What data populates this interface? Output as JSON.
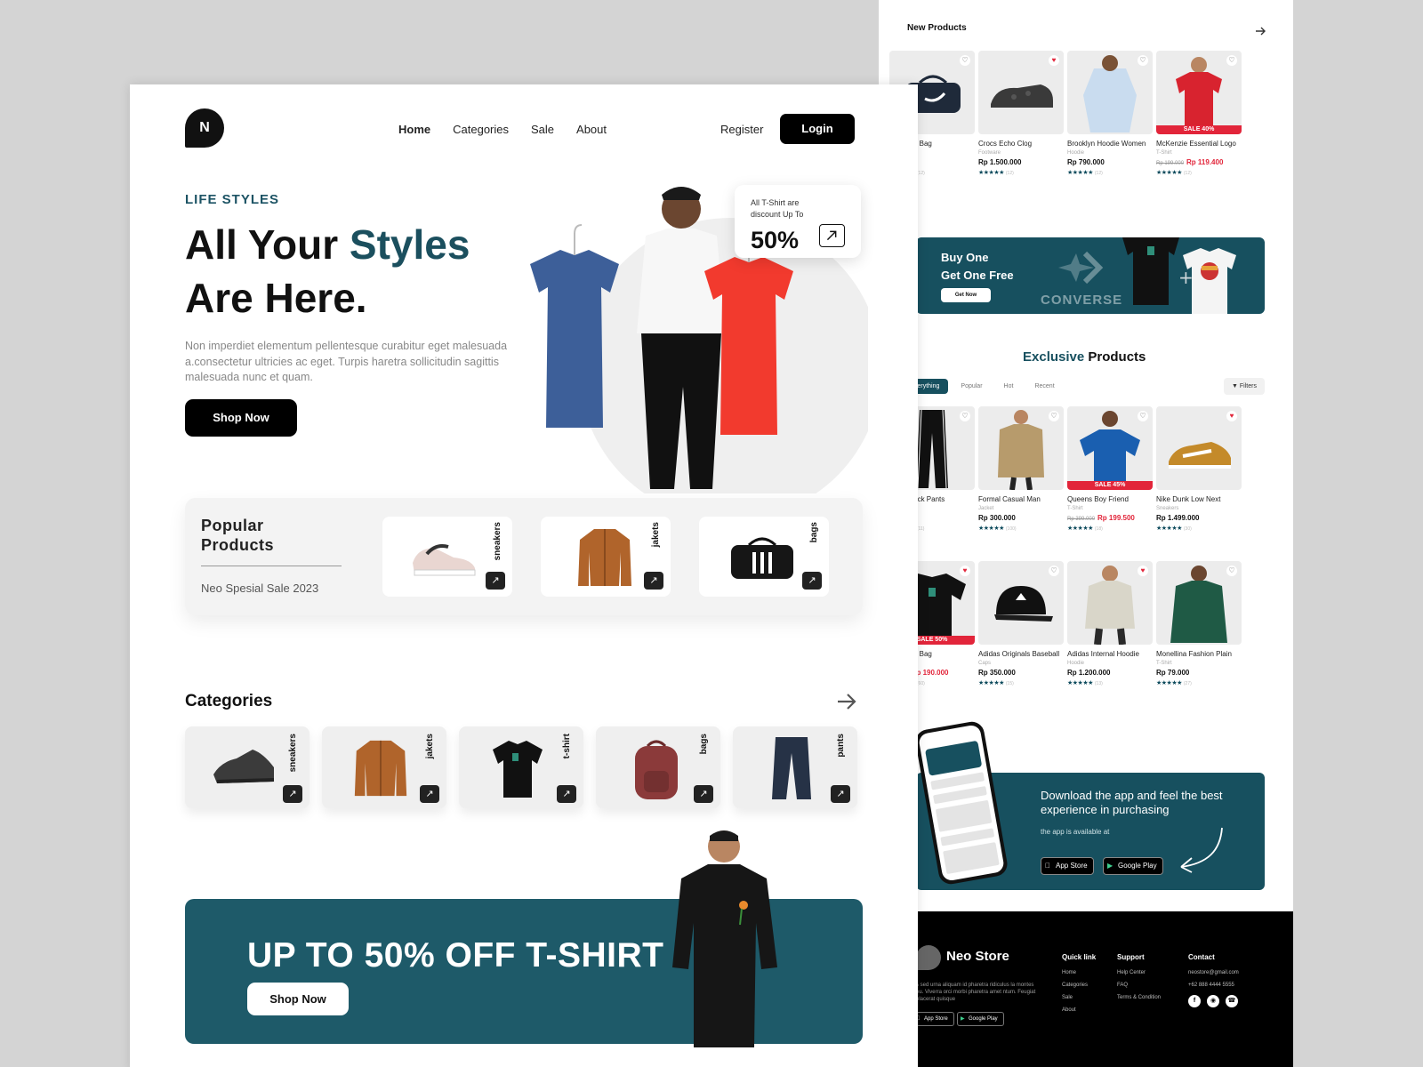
{
  "right": {
    "new_products_title": "New Products",
    "new_products": [
      {
        "name": "ke Duffle Bag",
        "cat": "gs",
        "price": "380.000",
        "reviews": "(12)",
        "heart": "outline",
        "img": "duffle-bag"
      },
      {
        "name": "Crocs Echo Clog",
        "cat": "Footware",
        "price": "Rp 1.500.000",
        "reviews": "(12)",
        "heart": "red",
        "img": "clog"
      },
      {
        "name": "Brooklyn Hoodie Women",
        "cat": "Hoodie",
        "price": "Rp 790.000",
        "reviews": "(12)",
        "heart": "outline",
        "img": "hoodie"
      },
      {
        "name": "McKenzie Essential Logo",
        "cat": "T-Shirt",
        "old_price": "Rp 199.000",
        "price": "Rp 119.400",
        "sale": "SALE 40%",
        "reviews": "(12)",
        "heart": "outline",
        "img": "tshirt-red"
      }
    ],
    "promo": {
      "line1": "Buy One",
      "line2": "Get One Free",
      "button": "Get Now",
      "brand": "CONVERSE"
    },
    "exclusive_title_a": "Exclusive",
    "exclusive_title_b": " Products",
    "tabs": [
      "verything",
      "Popular",
      "Hot",
      "Recent"
    ],
    "filters_label": "Filters",
    "exclusive_row1": [
      {
        "name": "ebird Track Pants",
        "cat": "nts",
        "price": "700.000",
        "reviews": "(11)",
        "heart": "outline",
        "img": "pants"
      },
      {
        "name": "Formal Casual Man",
        "cat": "Jacket",
        "price": "Rp 300.000",
        "reviews": "(100)",
        "heart": "outline",
        "img": "jacket"
      },
      {
        "name": "Queens Boy Friend",
        "cat": "T-Shirt",
        "old_price": "Rp 399.000",
        "price": "Rp 199.500",
        "sale": "SALE 45%",
        "reviews": "(18)",
        "heart": "outline",
        "img": "tshirt-blue"
      },
      {
        "name": "Nike Dunk Low Next",
        "cat": "Sneakers",
        "price": "Rp 1.499.000",
        "reviews": "(30)",
        "heart": "red",
        "img": "sneaker"
      }
    ],
    "exclusive_row2": [
      {
        "name": "ke Duffle Bag",
        "cat": "gs",
        "old_price": "800.000",
        "price": "Rp 190.000",
        "sale": "SALE 50%",
        "reviews": "(60)",
        "heart": "red",
        "img": "tshirt-black"
      },
      {
        "name": "Adidas Originals Baseball",
        "cat": "Caps",
        "price": "Rp 350.000",
        "reviews": "(15)",
        "heart": "outline",
        "img": "cap"
      },
      {
        "name": "Adidas Internal Hoodie",
        "cat": "Hoodie",
        "price": "Rp 1.200.000",
        "reviews": "(13)",
        "heart": "red",
        "img": "hoodie-man"
      },
      {
        "name": "Monellina Fashion Plain",
        "cat": "T-Shirt",
        "price": "Rp 79.000",
        "reviews": "(27)",
        "heart": "outline",
        "img": "green-top"
      }
    ],
    "app": {
      "heading": "Download the app and feel the best experience in purchasing",
      "sub": "the app is available at",
      "appstore": "App Store",
      "appstore_small": "Download on the",
      "googleplay": "Google Play",
      "googleplay_small": "GET IT ON"
    },
    "footer": {
      "brand": "Neo Store",
      "desc": "s sed urna aliquam id pharetra ridiculus la montes eu. Viverra orci morbi pharetra amet ntum. Feugiat placerat quisque",
      "quick_title": "Quick link",
      "quick": [
        "Home",
        "Categories",
        "Sale",
        "About"
      ],
      "support_title": "Support",
      "support": [
        "Help Center",
        "FAQ",
        "Terms & Condition"
      ],
      "contact_title": "Contact",
      "contact": [
        "neostore@gmail.com",
        "+62 888 4444 5555"
      ],
      "appstore": "App Store",
      "googleplay": "Google Play"
    }
  },
  "main": {
    "logo": "N",
    "nav": [
      "Home",
      "Categories",
      "Sale",
      "About"
    ],
    "register": "Register",
    "login": "Login",
    "kicker": "LIFE STYLES",
    "hero_line1a": "All Your ",
    "hero_line1b": "Styles",
    "hero_line2": "Are Here.",
    "hero_desc": "Non imperdiet elementum pellentesque curabitur eget malesuada a.consectetur ultricies ac eget. Turpis haretra sollicitudin sagittis malesuada nunc et quam.",
    "shop_now": "Shop Now",
    "discount": {
      "text": "All T-Shirt are discount Up To",
      "percent": "50%"
    },
    "popular": {
      "title": "Popular Products",
      "subtitle": "Neo Spesial Sale 2023",
      "items": [
        "sneakers",
        "jakets",
        "bags"
      ]
    },
    "categories_title": "Categories",
    "categories": [
      "sneakers",
      "jakets",
      "t-shirt",
      "bags",
      "pants"
    ],
    "sale_banner": {
      "text": "UP TO 50% OFF T-SHIRT",
      "button": "Shop Now"
    }
  },
  "colors": {
    "accent": "#17505f",
    "sale": "#e2253a",
    "ink": "#111111"
  }
}
